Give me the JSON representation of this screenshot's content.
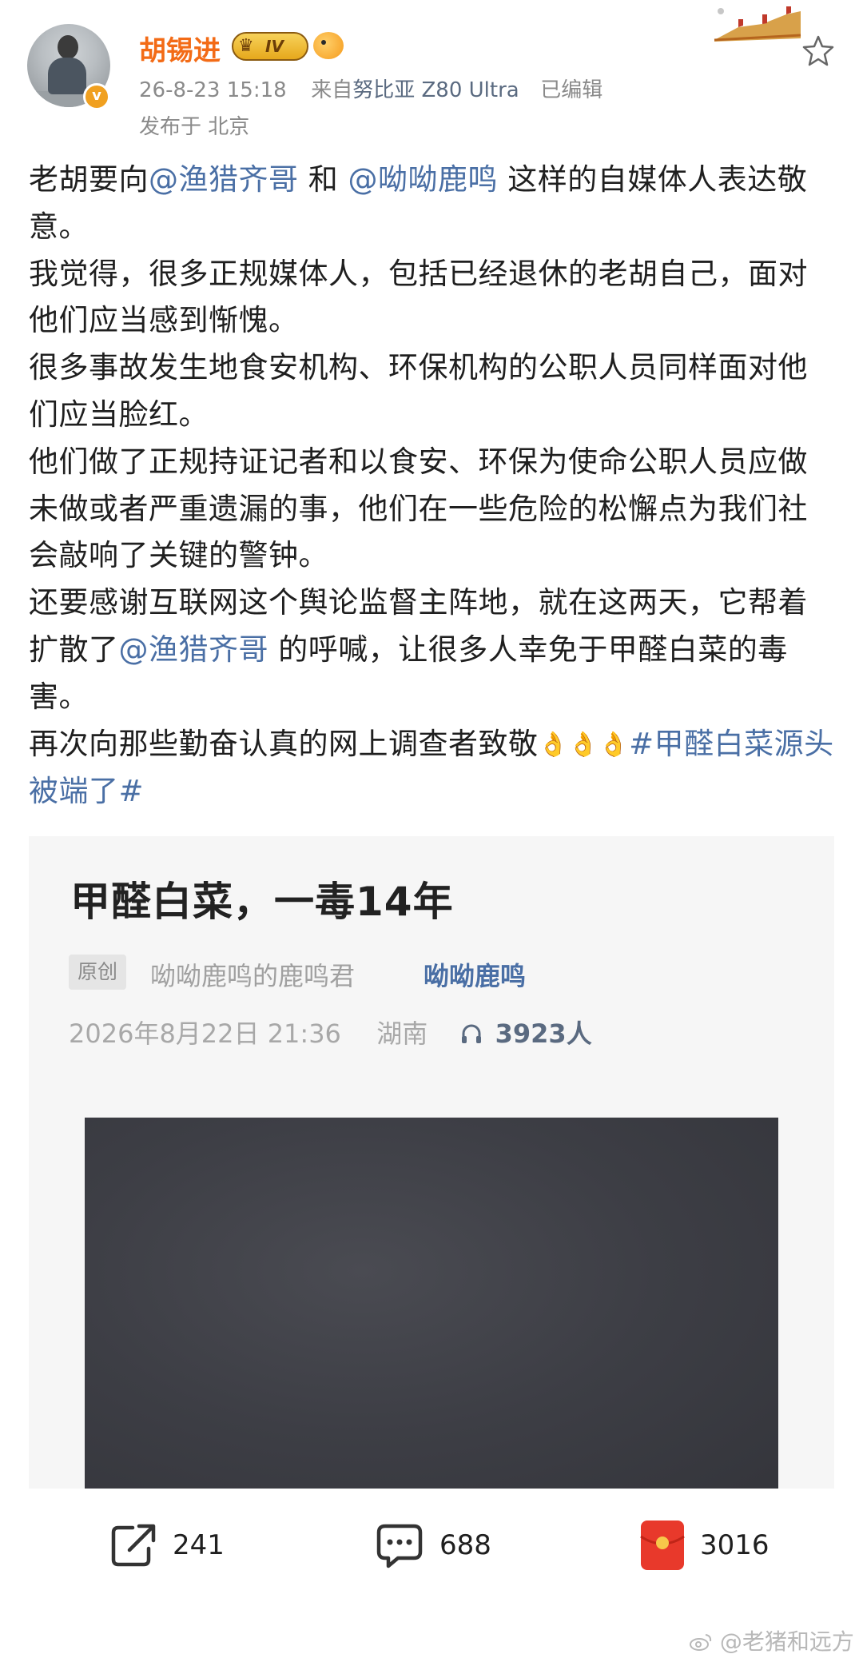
{
  "header": {
    "username": "胡锡进",
    "level": "IV",
    "meta": {
      "time": "26-8-23 15:18",
      "source_prefix": "来自",
      "device": "努比亚 Z80 Ultra",
      "edited": "已编辑"
    },
    "location": "发布于 北京",
    "verified_mark": "v"
  },
  "post": {
    "segments": [
      {
        "t": "text",
        "v": "老胡要向"
      },
      {
        "t": "mention",
        "v": "@渔猎齐哥"
      },
      {
        "t": "text",
        "v": " 和 "
      },
      {
        "t": "mention",
        "v": "@呦呦鹿鸣"
      },
      {
        "t": "text",
        "v": " 这样的自媒体人表达敬意。"
      }
    ],
    "p2": "我觉得，很多正规媒体人，包括已经退休的老胡自己，面对他们应当感到惭愧。",
    "p3": "很多事故发生地食安机构、环保机构的公职人员同样面对他们应当脸红。",
    "p4": "他们做了正规持证记者和以食安、环保为使命公职人员应做未做或者严重遗漏的事，他们在一些危险的松懈点为我们社会敲响了关键的警钟。",
    "p5_a": "还要感谢互联网这个舆论监督主阵地，就在这两天，它帮着扩散了",
    "p5_mention": "@渔猎齐哥",
    "p5_b": " 的呼喊，让很多人幸免于甲醛白菜的毒害。",
    "p6_a": "再次向那些勤奋认真的网上调查者致敬",
    "p6_emoji": "👌👌👌",
    "p6_hashtag": "#甲醛白菜源头被端了#"
  },
  "article": {
    "title": "甲醛白菜，一毒14年",
    "original_tag": "原创",
    "author": "呦呦鹿鸣的鹿鸣君",
    "account": "呦呦鹿鸣",
    "date": "2026年8月22日 21:36",
    "region": "湖南",
    "listeners": "3923人"
  },
  "actions": {
    "repost_count": "241",
    "comment_count": "688",
    "like_count": "3016"
  },
  "watermark": "@老猪和远方",
  "colors": {
    "username": "#f36b16",
    "link": "#4a6fa5",
    "meta": "#8a8a8a",
    "like_red": "#e8392b"
  },
  "icons": [
    "star-icon",
    "repost-icon",
    "comment-icon",
    "red-packet-icon",
    "headphones-icon",
    "weibo-logo-icon"
  ]
}
